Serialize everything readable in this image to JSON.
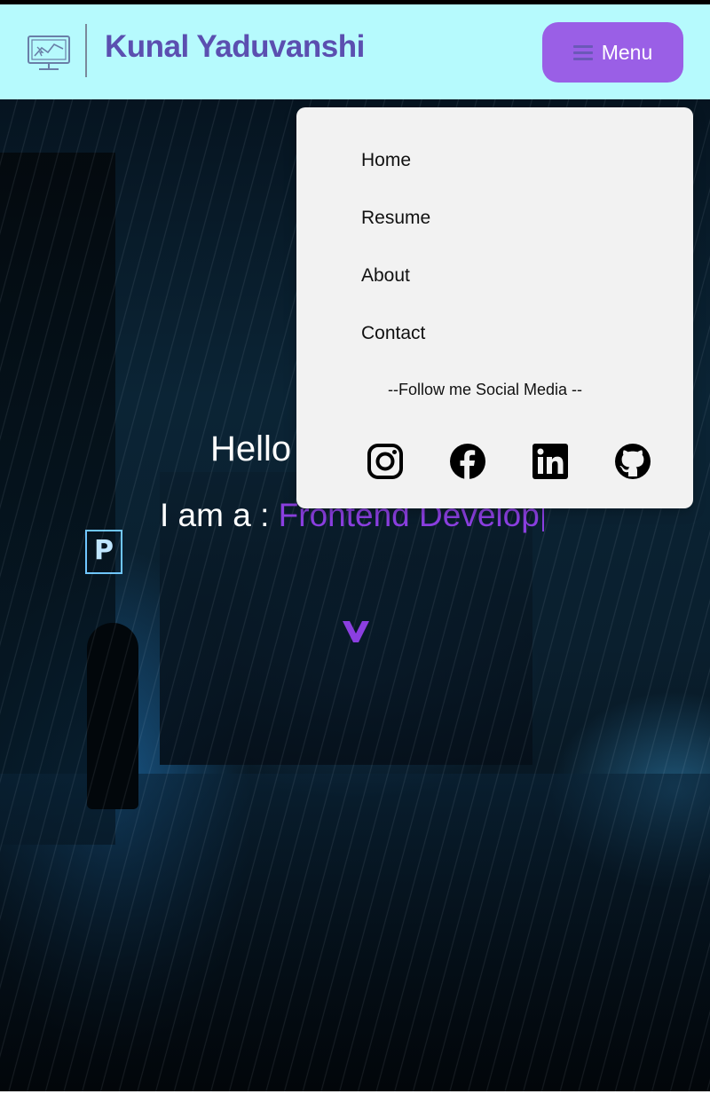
{
  "header": {
    "brand": "Kunal Yaduvanshi",
    "menu_label": "Menu",
    "logo_icon": "monitor-chart-icon",
    "background": "#b6fafd",
    "menu_color": "#9a5fe6"
  },
  "hero": {
    "greeting": "Hello",
    "role_prefix": "I am a : ",
    "role_text": "Frontend Develop",
    "scroll_icon": "chevron-down-icon",
    "accent": "#8b3fe0",
    "sign_letter": "P"
  },
  "menu": {
    "items": [
      {
        "label": "Home"
      },
      {
        "label": "Resume"
      },
      {
        "label": "About"
      },
      {
        "label": "Contact"
      }
    ],
    "follow_text": "--Follow me Social Media --",
    "social": [
      {
        "name": "instagram-icon"
      },
      {
        "name": "facebook-icon"
      },
      {
        "name": "linkedin-icon"
      },
      {
        "name": "github-icon"
      }
    ]
  }
}
